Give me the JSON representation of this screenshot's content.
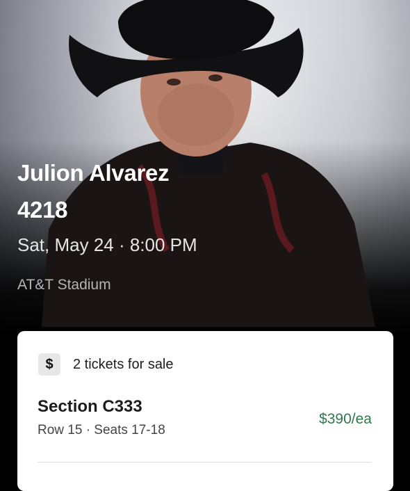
{
  "event": {
    "title_line1": "Julion Alvarez",
    "title_line2": "4218",
    "datetime": "Sat, May 24 · 8:00 PM",
    "venue": "AT&T Stadium"
  },
  "listing": {
    "sale_icon": "dollar-icon",
    "sale_icon_glyph": "$",
    "sale_text": "2 tickets for sale",
    "section": "Section C333",
    "row_seats": "Row 15 · Seats 17-18",
    "price": "$390/ea"
  },
  "colors": {
    "price": "#2e7a4c",
    "card_background": "#ffffff",
    "page_background": "#000000"
  }
}
